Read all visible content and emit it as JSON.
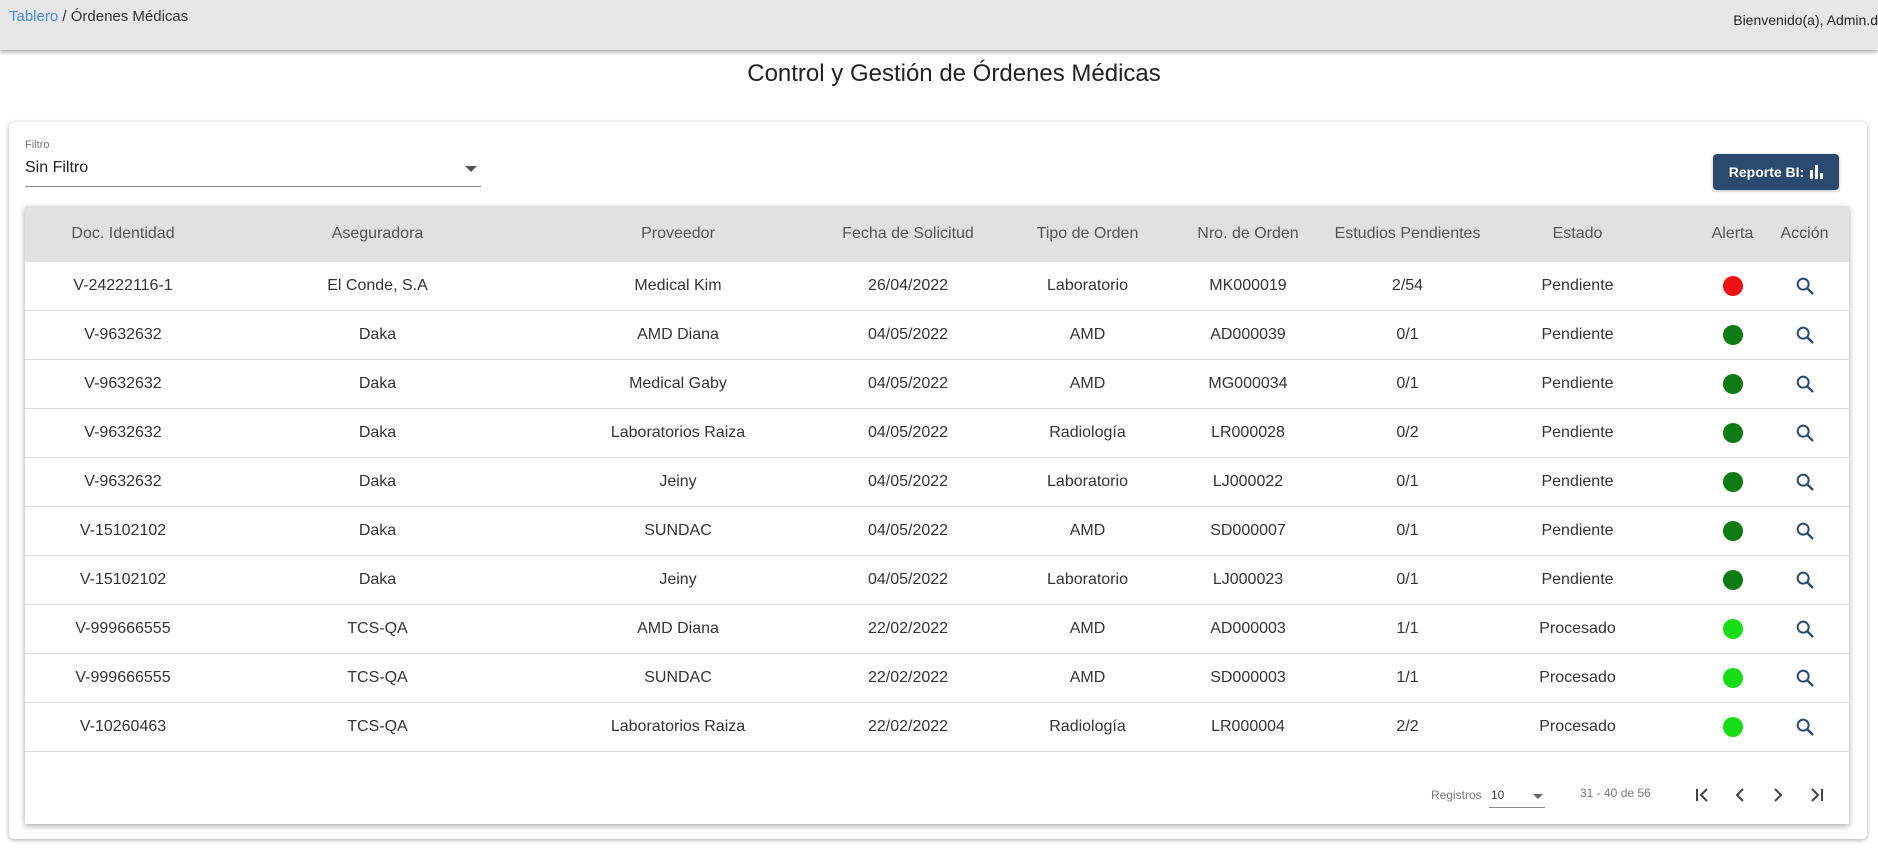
{
  "header": {
    "breadcrumb_link": "Tablero",
    "breadcrumb_separator": " / ",
    "breadcrumb_current": "Órdenes Médicas",
    "welcome": "Bienvenido(a), Admin.d"
  },
  "page_title": "Control y Gestión de Órdenes Médicas",
  "filter": {
    "label": "Filtro",
    "value": "Sin Filtro"
  },
  "bi_button": {
    "label": "Reporte BI:",
    "icon": "bar-chart-icon"
  },
  "table": {
    "headers": [
      "Doc. Identidad",
      "Aseguradora",
      "Proveedor",
      "Fecha de Solicitud",
      "Tipo de Orden",
      "Nro. de Orden",
      "Estudios Pendientes",
      "Estado",
      "Alerta",
      "Acción"
    ],
    "rows": [
      {
        "doc": "V-24222116-1",
        "aseguradora": "El Conde, S.A",
        "proveedor": "Medical Kim",
        "fecha": "26/04/2022",
        "tipo": "Laboratorio",
        "nro": "MK000019",
        "estudios": "2/54",
        "estado": "Pendiente",
        "alerta": "red"
      },
      {
        "doc": "V-9632632",
        "aseguradora": "Daka",
        "proveedor": "AMD Diana",
        "fecha": "04/05/2022",
        "tipo": "AMD",
        "nro": "AD000039",
        "estudios": "0/1",
        "estado": "Pendiente",
        "alerta": "dark-green"
      },
      {
        "doc": "V-9632632",
        "aseguradora": "Daka",
        "proveedor": "Medical Gaby",
        "fecha": "04/05/2022",
        "tipo": "AMD",
        "nro": "MG000034",
        "estudios": "0/1",
        "estado": "Pendiente",
        "alerta": "dark-green"
      },
      {
        "doc": "V-9632632",
        "aseguradora": "Daka",
        "proveedor": "Laboratorios Raiza",
        "fecha": "04/05/2022",
        "tipo": "Radiología",
        "nro": "LR000028",
        "estudios": "0/2",
        "estado": "Pendiente",
        "alerta": "dark-green"
      },
      {
        "doc": "V-9632632",
        "aseguradora": "Daka",
        "proveedor": "Jeiny",
        "fecha": "04/05/2022",
        "tipo": "Laboratorio",
        "nro": "LJ000022",
        "estudios": "0/1",
        "estado": "Pendiente",
        "alerta": "dark-green"
      },
      {
        "doc": "V-15102102",
        "aseguradora": "Daka",
        "proveedor": "SUNDAC",
        "fecha": "04/05/2022",
        "tipo": "AMD",
        "nro": "SD000007",
        "estudios": "0/1",
        "estado": "Pendiente",
        "alerta": "dark-green"
      },
      {
        "doc": "V-15102102",
        "aseguradora": "Daka",
        "proveedor": "Jeiny",
        "fecha": "04/05/2022",
        "tipo": "Laboratorio",
        "nro": "LJ000023",
        "estudios": "0/1",
        "estado": "Pendiente",
        "alerta": "dark-green"
      },
      {
        "doc": "V-999666555",
        "aseguradora": "TCS-QA",
        "proveedor": "AMD Diana",
        "fecha": "22/02/2022",
        "tipo": "AMD",
        "nro": "AD000003",
        "estudios": "1/1",
        "estado": "Procesado",
        "alerta": "light-green"
      },
      {
        "doc": "V-999666555",
        "aseguradora": "TCS-QA",
        "proveedor": "SUNDAC",
        "fecha": "22/02/2022",
        "tipo": "AMD",
        "nro": "SD000003",
        "estudios": "1/1",
        "estado": "Procesado",
        "alerta": "light-green"
      },
      {
        "doc": "V-10260463",
        "aseguradora": "TCS-QA",
        "proveedor": "Laboratorios Raiza",
        "fecha": "22/02/2022",
        "tipo": "Radiología",
        "nro": "LR000004",
        "estudios": "2/2",
        "estado": "Procesado",
        "alerta": "light-green"
      }
    ]
  },
  "alert_colors": {
    "red": "#ee1111",
    "dark-green": "#0e7a12",
    "light-green": "#17dd17"
  },
  "paginator": {
    "label": "Registros",
    "page_size": "10",
    "range": "31 - 40 de 56",
    "buttons": [
      "first-page-icon",
      "previous-page-icon",
      "next-page-icon",
      "last-page-icon"
    ]
  },
  "colors": {
    "accent": "#2b4a6f",
    "link": "#4a8be0",
    "header_bg": "#e0e0e0",
    "topbar_bg": "#e6e6e6"
  }
}
